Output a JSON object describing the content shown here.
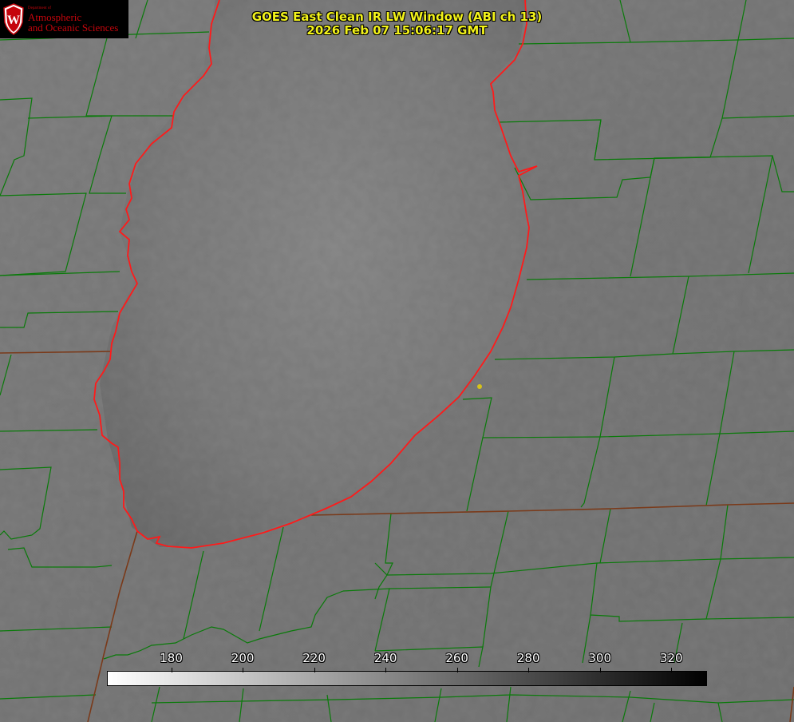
{
  "title": {
    "line1": "GOES East Clean IR LW Window (ABI ch 13)",
    "line2": "2026 Feb 07 15:06:17 GMT"
  },
  "logo": {
    "small_text": "Department of",
    "line1": "Atmospheric",
    "line2": "and Oceanic Sciences",
    "shield_letter": "W"
  },
  "colorbar": {
    "min": 162,
    "max": 330,
    "ticks": [
      "180",
      "200",
      "220",
      "240",
      "260",
      "280",
      "300",
      "320"
    ],
    "tick_values": [
      180,
      200,
      220,
      240,
      260,
      280,
      300,
      320
    ],
    "color_low": "#ffffff",
    "color_high": "#000000"
  },
  "colors": {
    "county_lines": "#0a7a0a",
    "coastline": "#ff1a1a",
    "title_text": "#f2f21a",
    "logo_red": "#c5050c",
    "marker": "#d6c21a"
  }
}
